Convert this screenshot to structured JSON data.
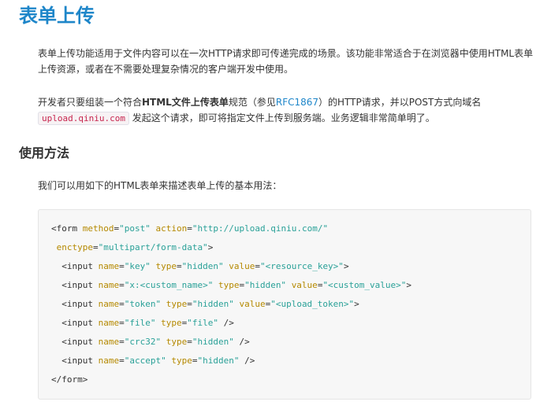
{
  "page": {
    "title": "表单上传",
    "intro": "表单上传功能适用于文件内容可以在一次HTTP请求即可传递完成的场景。该功能非常适合于在浏览器中使用HTML表单上传资源，或者在不需要处理复杂情况的客户端开发中使用。",
    "para2": {
      "before_bold": "开发者只要组装一个符合",
      "bold": "HTML文件上传表单",
      "after_bold": "规范（参见",
      "link_text": "RFC1867",
      "after_link": "）的HTTP请求，并以POST方式向域名",
      "code": "upload.qiniu.com",
      "end": "发起这个请求，即可将指定文件上传到服务端。业务逻辑非常简单明了。"
    },
    "subtitle": "使用方法",
    "usage_intro": "我们可以用如下的HTML表单来描述表单上传的基本用法：",
    "code_lines": [
      "<form method=\"post\" action=\"http://upload.qiniu.com/\"",
      " enctype=\"multipart/form-data\">",
      "  <input name=\"key\" type=\"hidden\" value=\"<resource_key>\">",
      "  <input name=\"x:<custom_name>\" type=\"hidden\" value=\"<custom_value>\">",
      "  <input name=\"token\" type=\"hidden\" value=\"<upload_token>\">",
      "  <input name=\"file\" type=\"file\" />",
      "  <input name=\"crc32\" type=\"hidden\" />",
      "  <input name=\"accept\" type=\"hidden\" />",
      "</form>"
    ]
  }
}
